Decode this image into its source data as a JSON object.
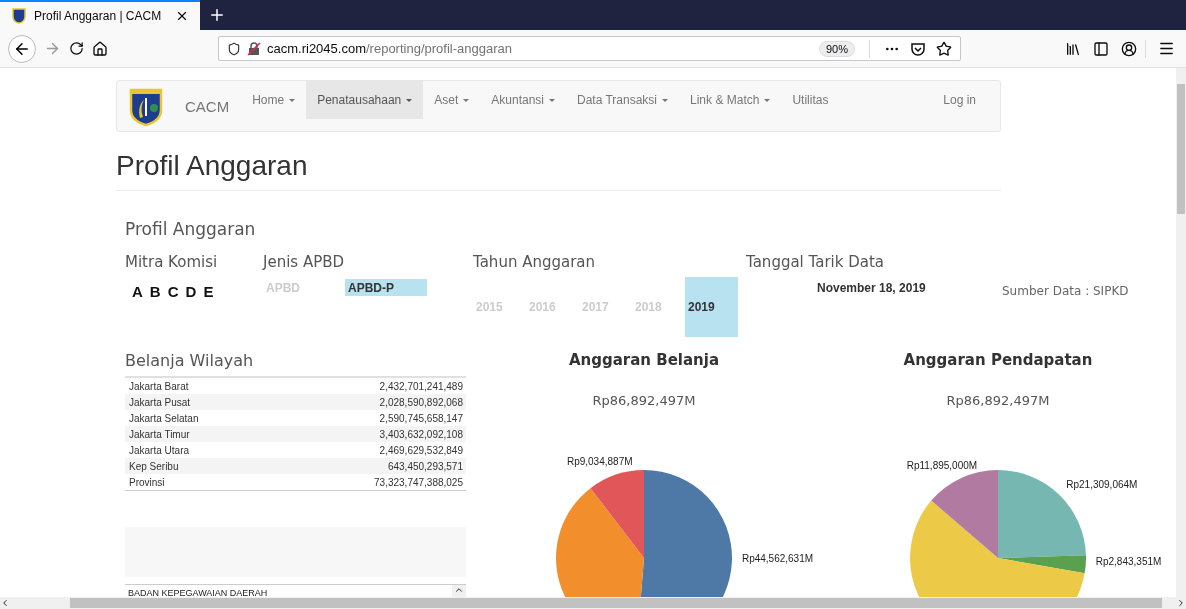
{
  "browser": {
    "tab": {
      "title": "Profil Anggaran | CACM",
      "selected": true
    },
    "url_host": "cacm.ri2045.com",
    "url_path": "/reporting/profil-anggaran",
    "zoom": "90%"
  },
  "navbar": {
    "brand": "CACM",
    "login": "Log in",
    "items": [
      {
        "label": "Home",
        "dropdown": true,
        "selected": false
      },
      {
        "label": "Penatausahaan",
        "dropdown": true,
        "selected": true
      },
      {
        "label": "Aset",
        "dropdown": true,
        "selected": false
      },
      {
        "label": "Akuntansi",
        "dropdown": true,
        "selected": false
      },
      {
        "label": "Data Transaksi",
        "dropdown": true,
        "selected": false
      },
      {
        "label": "Link & Match",
        "dropdown": true,
        "selected": false
      },
      {
        "label": "Utilitas",
        "dropdown": false,
        "selected": false
      }
    ]
  },
  "page_title": "Profil Anggaran",
  "dashboard": {
    "title": "Profil Anggaran",
    "mitra_komisi": {
      "label": "Mitra Komisi",
      "options": [
        "A",
        "B",
        "C",
        "D",
        "E"
      ]
    },
    "jenis_apbd": {
      "label": "Jenis APBD",
      "options": [
        {
          "label": "APBD",
          "selected": false
        },
        {
          "label": "APBD-P",
          "selected": true
        }
      ]
    },
    "tahun_anggaran": {
      "label": "Tahun Anggaran",
      "options": [
        {
          "label": "2015",
          "selected": false
        },
        {
          "label": "2016",
          "selected": false
        },
        {
          "label": "2017",
          "selected": false
        },
        {
          "label": "2018",
          "selected": false
        },
        {
          "label": "2019",
          "selected": true
        }
      ]
    },
    "tanggal_tarik_data": {
      "label": "Tanggal Tarik Data",
      "value": "November 18, 2019"
    },
    "sumber_data": "Sumber Data : SIPKD",
    "belanja_wilayah": {
      "title": "Belanja Wilayah",
      "rows": [
        {
          "region": "Jakarta Barat",
          "amount": "2,432,701,241,489"
        },
        {
          "region": "Jakarta Pusat",
          "amount": "2,028,590,892,068"
        },
        {
          "region": "Jakarta Selatan",
          "amount": "2,590,745,658,147"
        },
        {
          "region": "Jakarta Timur",
          "amount": "3,403,632,092,108"
        },
        {
          "region": "Jakarta Utara",
          "amount": "2,469,629,532,849"
        },
        {
          "region": "Kep Seribu",
          "amount": "643,450,293,571"
        },
        {
          "region": "Provinsi",
          "amount": "73,323,747,388,025"
        }
      ]
    },
    "unit_list": {
      "items": [
        "BADAN KEPEGAWAIAN DAERAH"
      ]
    },
    "charts": [
      {
        "total": "Rp86,892,497M",
        "chart_data": {
          "type": "pie",
          "title": "Anggaran Belanja",
          "values": [
            51.28,
            38.32,
            10.4
          ],
          "value_labels": [
            "Rp44,562,631M",
            null,
            "Rp9,034,887M"
          ]
        }
      },
      {
        "total": "Rp86,892,497M",
        "chart_data": {
          "type": "pie",
          "title": "Anggaran Pendapatan",
          "values": [
            24.52,
            3.27,
            58.52,
            13.69
          ],
          "value_labels": [
            "Rp21,309,064M",
            "Rp2,843,351M",
            null,
            "Rp11,895,000M"
          ]
        }
      }
    ]
  }
}
